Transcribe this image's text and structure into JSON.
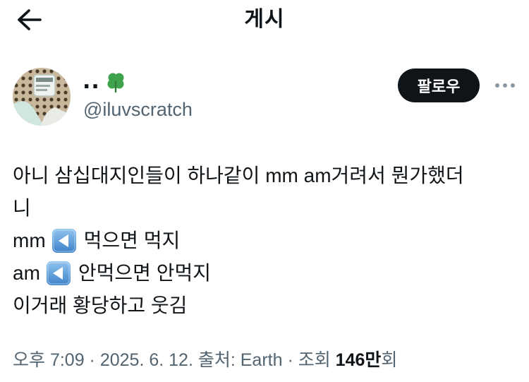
{
  "header": {
    "title": "게시"
  },
  "author": {
    "display_name": "..",
    "display_emoji": "clover-icon",
    "handle": "@iluvscratch",
    "follow_label": "팔로우"
  },
  "tweet": {
    "line1": "아니 삼십대지인들이 하나같이 mm am거려서 뭔가했더",
    "line2": "니",
    "line3_prefix": "mm",
    "line3_suffix": "먹으면 먹지",
    "line4_prefix": "am",
    "line4_suffix": "안먹으면 안먹지",
    "line5": "이거래 황당하고 웃김",
    "inline_icon": "left-triangle-button-icon"
  },
  "meta": {
    "time": "오후 7:09",
    "sep1": " · ",
    "date": "2025. 6. 12.",
    "sep2": " ",
    "source_label": "출처: Earth",
    "sep3": " · ",
    "views_label": "조회 ",
    "views_count": "146만",
    "views_suffix": "회"
  },
  "colors": {
    "text": "#0f1419",
    "secondary": "#536471",
    "follow_bg": "#0f1419",
    "clover": "#3fa34d",
    "key_icon": "#4a90d9"
  }
}
